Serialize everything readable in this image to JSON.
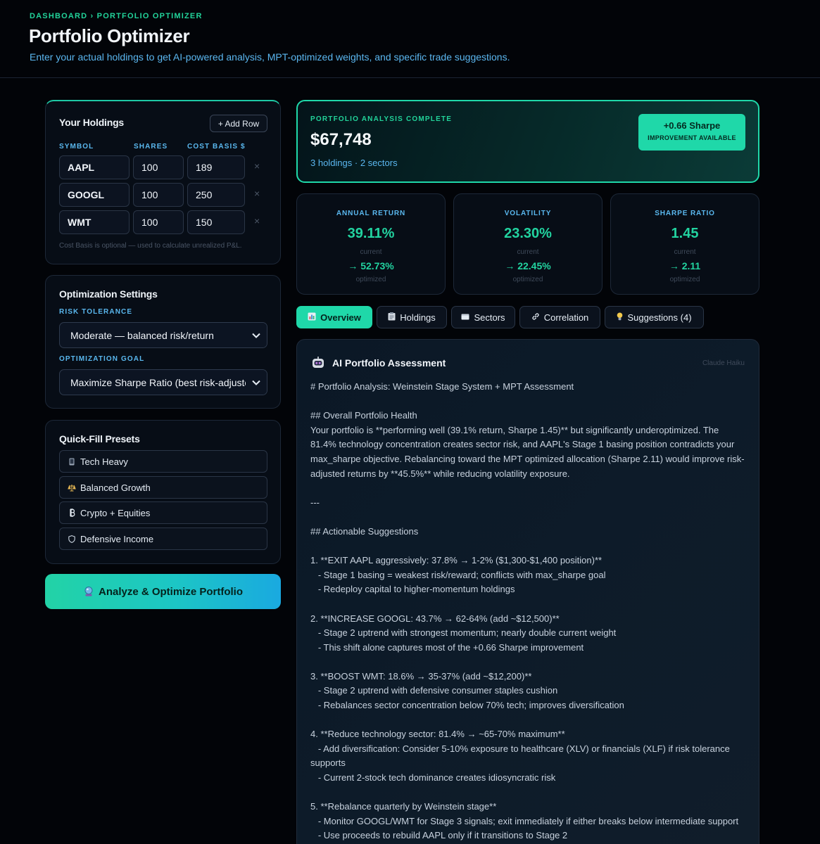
{
  "header": {
    "breadcrumb": "DASHBOARD › PORTFOLIO OPTIMIZER",
    "title": "Portfolio Optimizer",
    "subtitle": "Enter your actual holdings to get AI-powered analysis, MPT-optimized weights, and specific trade suggestions."
  },
  "holdings": {
    "title": "Your Holdings",
    "add_row": "+ Add Row",
    "col_symbol": "SYMBOL",
    "col_shares": "SHARES",
    "col_cost": "COST BASIS $",
    "rows": [
      {
        "symbol": "AAPL",
        "shares": "100",
        "cost": "189"
      },
      {
        "symbol": "GOOGL",
        "shares": "100",
        "cost": "250"
      },
      {
        "symbol": "WMT",
        "shares": "100",
        "cost": "150"
      }
    ],
    "remove_glyph": "×",
    "hint": "Cost Basis is optional — used to calculate unrealized P&L."
  },
  "settings": {
    "title": "Optimization Settings",
    "risk_label": "RISK TOLERANCE",
    "risk_value": "Moderate — balanced risk/return",
    "goal_label": "OPTIMIZATION GOAL",
    "goal_value": "Maximize Sharpe Ratio (best risk-adjusted)"
  },
  "presets": {
    "title": "Quick-Fill Presets",
    "items": [
      {
        "label": "Tech Heavy",
        "icon": "phone-icon"
      },
      {
        "label": "Balanced Growth",
        "icon": "scale-icon"
      },
      {
        "label": "Crypto + Equities",
        "icon": "bitcoin-icon"
      },
      {
        "label": "Defensive Income",
        "icon": "shield-icon"
      }
    ]
  },
  "analyze_button": "Analyze & Optimize Portfolio",
  "summary": {
    "label": "PORTFOLIO ANALYSIS COMPLETE",
    "value": "$67,748",
    "meta": "3 holdings · 2 sectors",
    "badge_main": "+0.66 Sharpe",
    "badge_sub": "IMPROVEMENT AVAILABLE"
  },
  "metrics": [
    {
      "label": "ANNUAL RETURN",
      "current": "39.11%",
      "current_caption": "current",
      "optimized": "→ 52.73%",
      "optimized_caption": "optimized"
    },
    {
      "label": "VOLATILITY",
      "current": "23.30%",
      "current_caption": "current",
      "optimized": "→ 22.45%",
      "optimized_caption": "optimized"
    },
    {
      "label": "SHARPE RATIO",
      "current": "1.45",
      "current_caption": "current",
      "optimized": "→ 2.11",
      "optimized_caption": "optimized"
    }
  ],
  "tabs": [
    {
      "label": "Overview",
      "icon": "chart-icon"
    },
    {
      "label": "Holdings",
      "icon": "clipboard-icon"
    },
    {
      "label": "Sectors",
      "icon": "pie-icon"
    },
    {
      "label": "Correlation",
      "icon": "link-icon"
    },
    {
      "label": "Suggestions (4)",
      "icon": "bulb-icon"
    }
  ],
  "assessment": {
    "title": "AI Portfolio Assessment",
    "model": "Claude Haiku",
    "lines": [
      "# Portfolio Analysis: Weinstein Stage System + MPT Assessment",
      "",
      "## Overall Portfolio Health",
      "Your portfolio is **performing well (39.1% return, Sharpe 1.45)** but significantly underoptimized. The",
      "81.4% technology concentration creates sector risk, and AAPL's Stage 1 basing position contradicts your",
      "max_sharpe objective. Rebalancing toward the MPT optimized allocation (Sharpe 2.11) would improve risk-",
      "adjusted returns by **45.5%** while reducing volatility exposure.",
      "",
      "---",
      "",
      "## Actionable Suggestions",
      "",
      "1. **EXIT AAPL aggressively: 37.8% → 1-2% ($1,300-$1,400 position)**",
      "   - Stage 1 basing = weakest risk/reward; conflicts with max_sharpe goal",
      "   - Redeploy capital to higher-momentum holdings",
      "",
      "2. **INCREASE GOOGL: 43.7% → 62-64% (add ~$12,500)**",
      "   - Stage 2 uptrend with strongest momentum; nearly double current weight",
      "   - This shift alone captures most of the +0.66 Sharpe improvement",
      "",
      "3. **BOOST WMT: 18.6% → 35-37% (add ~$12,200)**",
      "   - Stage 2 uptrend with defensive consumer staples cushion",
      "   - Rebalances sector concentration below 70% tech; improves diversification",
      "",
      "4. **Reduce technology sector: 81.4% → ~65-70% maximum**",
      "   - Add diversification: Consider 5-10% exposure to healthcare (XLV) or financials (XLF) if risk tolerance",
      "supports",
      "   - Current 2-stock tech dominance creates idiosyncratic risk",
      "",
      "5. **Rebalance quarterly by Weinstein stage**",
      "   - Monitor GOOGL/WMT for Stage 3 signals; exit immediately if either breaks below intermediate support",
      "   - Use proceeds to rebuild AAPL only if it transitions to Stage 2"
    ]
  },
  "colors": {
    "accent": "#1fd8a9",
    "link": "#5bb7f0",
    "background": "#020408"
  }
}
